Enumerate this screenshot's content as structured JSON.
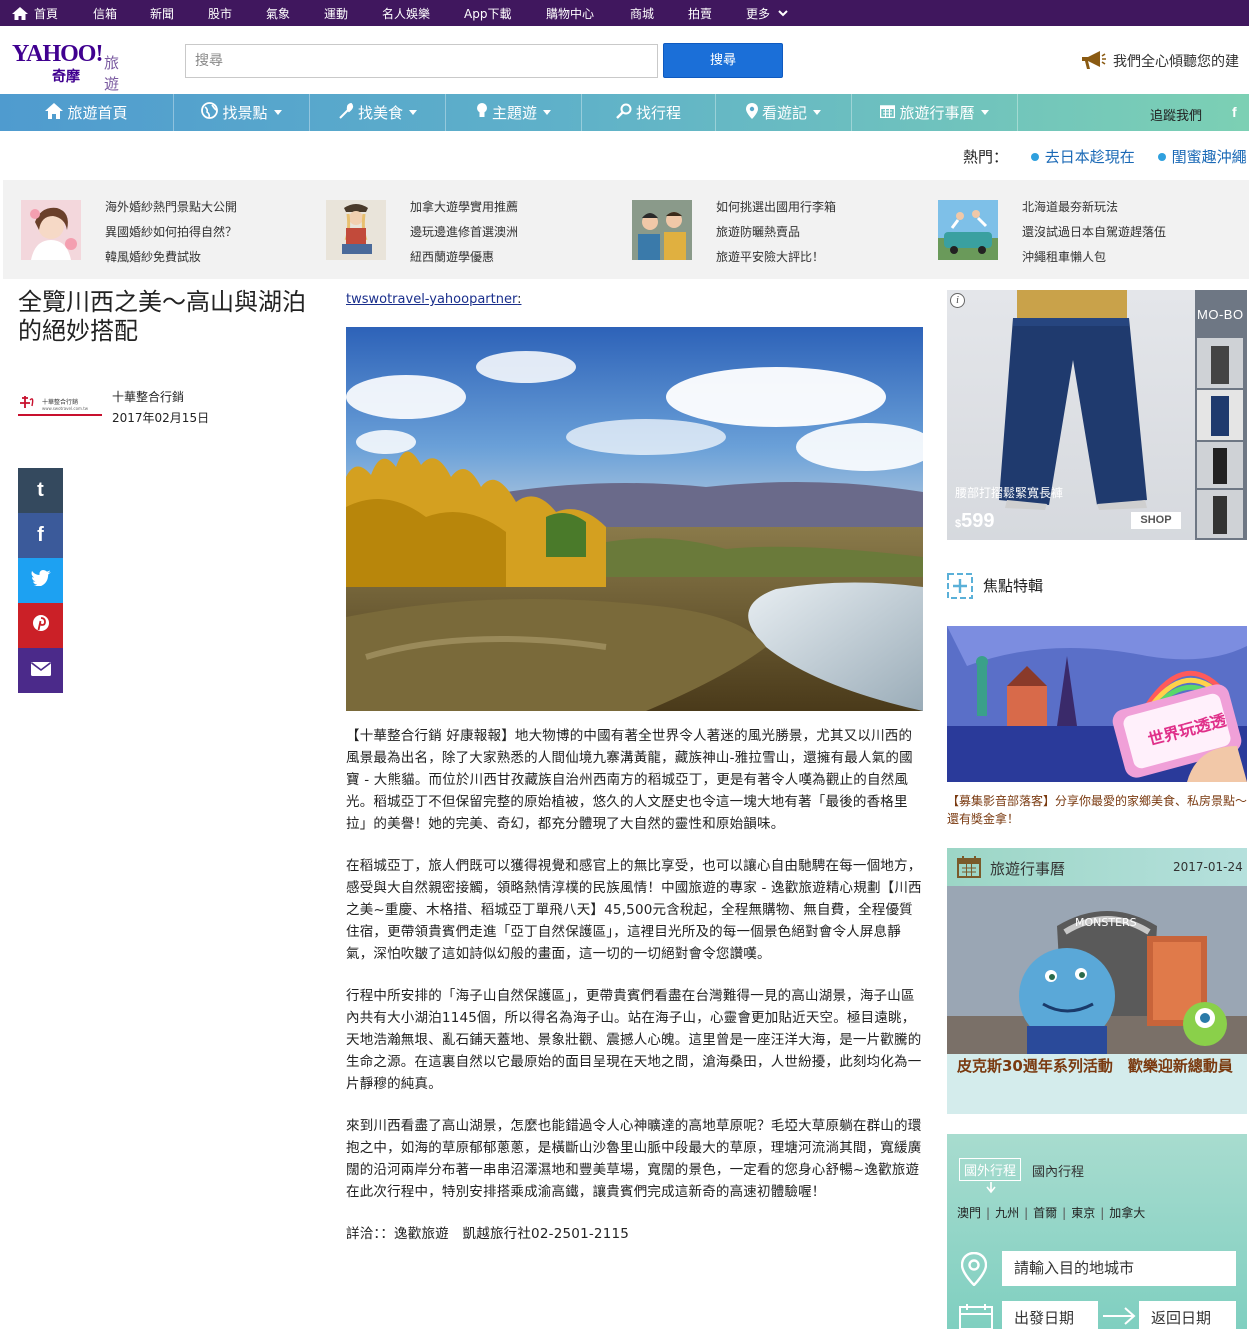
{
  "topbar": {
    "items": [
      "首頁",
      "信箱",
      "新聞",
      "股市",
      "氣象",
      "運動",
      "名人娛樂",
      "App下載",
      "購物中心",
      "商城",
      "拍賣",
      "更多"
    ]
  },
  "header": {
    "logo_text": "YAHOO!",
    "logo_sub": "奇摩",
    "section": "旅遊",
    "search_placeholder": "搜尋",
    "search_button": "搜尋",
    "slogan": "我們全心傾聽您的建"
  },
  "nav": {
    "items": [
      {
        "label": "旅遊首頁",
        "icon": "home-icon"
      },
      {
        "label": "找景點",
        "icon": "globe-icon"
      },
      {
        "label": "找美食",
        "icon": "utensils-icon"
      },
      {
        "label": "主題遊",
        "icon": "bulb-icon"
      },
      {
        "label": "找行程",
        "icon": "search-icon"
      },
      {
        "label": "看遊記",
        "icon": "location-pin-icon"
      },
      {
        "label": "旅遊行事曆",
        "icon": "calendar-icon"
      }
    ],
    "follow": "追蹤我們",
    "facebook": "f"
  },
  "hot": {
    "label": "熱門：",
    "links": [
      "去日本趁現在",
      "閨蜜趣沖繩"
    ]
  },
  "promo": [
    {
      "links": [
        "海外婚紗熱門景點大公開",
        "異國婚紗如何拍得自然？",
        "韓風婚紗免費試妝"
      ]
    },
    {
      "links": [
        "加拿大遊學實用推薦",
        "邊玩邊進修首選澳洲",
        "紐西蘭遊學優惠"
      ]
    },
    {
      "links": [
        "如何挑選出國用行李箱",
        "旅遊防曬熱賣品",
        "旅遊平安險大評比！"
      ]
    },
    {
      "links": [
        "北海道最夯新玩法",
        "還沒試過日本自駕遊趕落伍",
        "沖繩租車懶人包"
      ]
    }
  ],
  "article": {
    "title": "全覽川西之美～高山與湖泊的絕妙搭配",
    "author": "十華整合行銷",
    "date": "2017年02月15日",
    "author_logo_text": "十華整合行銷",
    "author_logo_url": "www.swotravel.com.tw",
    "source": "twswotravel-yahoopartner",
    "source_colon": ":",
    "paragraphs": [
      "【十華整合行銷 好康報報】地大物博的中國有著全世界令人著迷的風光勝景，尤其又以川西的風景最為出名，除了大家熟悉的人間仙境九寨溝黃龍，藏族神山-雅拉雪山，還擁有最人氣的國寶 - 大熊貓。而位於川西甘孜藏族自治州西南方的稻城亞丁，更是有著令人嘆為觀止的自然風光。稻城亞丁不但保留完整的原始植被，悠久的人文歷史也令這一塊大地有著「最後的香格里拉」的美譽！她的完美、奇幻，都充分體現了大自然的靈性和原始韻味。",
      "在稻城亞丁，旅人們既可以獲得視覺和感官上的無比享受，也可以讓心自由馳騁在每一個地方，感受與大自然親密接觸，領略熱情淳樸的民族風情！中國旅遊的專家 - 逸歡旅遊精心規劃【川西之美~重慶、木格措、稻城亞丁單飛八天】45,500元含稅起，全程無購物、無自費，全程優質住宿，更帶領貴賓們走進「亞丁自然保護區」，這裡目光所及的每一個景色絕對會令人屏息靜氣，深怕吹皺了這如詩似幻般的畫面，這一切的一切絕對會令您讚嘆。",
      "行程中所安排的「海子山自然保護區」，更帶貴賓們看盡在台灣難得一見的高山湖景，海子山區內共有大小湖泊1145個，所以得名為海子山。站在海子山，心靈會更加貼近天空。極目遠眺，天地浩瀚無垠、亂石鋪天蓋地、景象壯觀、震撼人心魄。這里曾是一座汪洋大海，是一片歡騰的生命之源。在這裏自然以它最原始的面目呈現在天地之間，滄海桑田，人世紛擾，此刻均化為一片靜穆的純真。",
      "來到川西看盡了高山湖景，怎麼也能錯過令人心神曠達的高地草原呢？毛埡大草原躺在群山的環抱之中，如海的草原郁郁蔥蔥，是橫斷山沙魯里山脈中段最大的草原，理塘河流淌其間，寬緩廣闊的沿河兩岸分布著一串串沼澤濕地和豐美草場，寬闊的景色，一定看的您身心舒暢~逸歡旅遊在此次行程中，特別安排搭乘成渝高鐵，讓貴賓們完成這新奇的高速初體驗喔！",
      "詳洽：：逸歡旅遊　凱越旅行社02-2501-2115"
    ]
  },
  "share": {
    "buttons": [
      {
        "name": "tumblr",
        "glyph": "t",
        "color": "#34495e"
      },
      {
        "name": "facebook",
        "glyph": "f",
        "color": "#3b5a9a"
      },
      {
        "name": "twitter",
        "glyph": "🐦",
        "color": "#1da1f2"
      },
      {
        "name": "pinterest",
        "glyph": "p",
        "color": "#cb2027"
      },
      {
        "name": "email",
        "glyph": "✉",
        "color": "#4b2a8a"
      }
    ]
  },
  "ad": {
    "brand": "MO-BO",
    "caption": "腰部打摺鬆緊寬長褲",
    "currency": "$",
    "price": "599",
    "shop": "SHOP",
    "info": "i"
  },
  "focus": {
    "label": "焦點特輯",
    "caption": "【募集影音部落客】分享你最愛的家鄉美食、私房景點～還有獎金拿！",
    "image_text": "世界玩透透"
  },
  "calendar": {
    "label": "旅遊行事曆",
    "date": "2017-01-24",
    "caption": "皮克斯30週年系列活動　歡樂迎新總動員",
    "image_sign": "MONSTERS"
  },
  "trip": {
    "tab_active": "國外行程",
    "tab": "國內行程",
    "cities": [
      "澳門",
      "九州",
      "首爾",
      "東京",
      "加拿大"
    ],
    "destination_placeholder": "請輸入目的地城市",
    "depart": "出發日期",
    "return": "返回日期"
  }
}
